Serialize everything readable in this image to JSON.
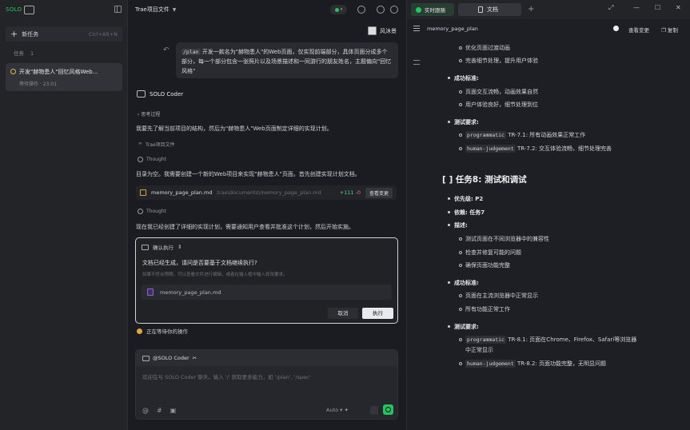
{
  "left": {
    "logo_text": "SOLO",
    "logo_box": "⊡",
    "new_task_label": "新任务",
    "new_task_shortcut": "Ctrl+Alt+N",
    "tasks_label": "任务",
    "tasks_count": "1",
    "task_title": "开发\"赫物患人\"回忆风格Web...",
    "task_status": "等待操作 · 23:01"
  },
  "mid": {
    "project_title": "Trae项目文件",
    "status_indicator": "on",
    "user_name": "风沐景",
    "user_bubble_cmd": "/plan",
    "user_bubble_text": "开发一款名为\"赫物患人\"的Web页面，仅实现前端部分，具体页面分成多个部分，每一个部分包含一张照片以及场景描述和一同游行的朋友姓名，主题偏向\"回忆风格\"",
    "agent_name": "SOLO Coder",
    "thinking_label": "思考过程",
    "msg1": "我要先了解当前项目的结构，然后为\"赫物患人\"Web页面制定详细的实现计划。",
    "ref_label": "Trae项目文件",
    "thought_label": "Thought",
    "msg2": "目录为空。我需要创建一个新的Web项目来实现\"赫物患人\"页面。首先创建实现计划文档。",
    "file_name": "memory_page_plan.md",
    "file_path": ".trae\\documents\\memory_page_plan.md",
    "file_add": "+111",
    "file_del": "-0",
    "view_change_btn": "查看变更",
    "thought_label2": "Thought",
    "msg3": "现在我已经创建了详细的实现计划，需要通知用户查看并批准这个计划，然后开始实施。",
    "confirm_header": "确认执行",
    "confirm_question": "文档已经生成，请问是否要基于文档继续执行?",
    "confirm_hint": "如果不符合预期，可以查看文件进行编辑，或者在输入框中输入修改要求。",
    "confirm_file": "memory_page_plan.md",
    "cancel_label": "取消",
    "execute_label": "执行",
    "waiting_text": "正在等待你的操作",
    "input_agent": "@SOLO Coder",
    "input_placeholder": "欢迎在与 SOLO Coder 聊天。输入 '/' 获取更多能力，如 '/plan', '/spec'",
    "model_label": "Auto",
    "accent_color": "#22c55e"
  },
  "right": {
    "tab_live": "实时跟随",
    "tab_doc": "文档",
    "doc_filename": "memory_page_plan",
    "view_changes": "查看变更",
    "copy": "复制",
    "lines": {
      "a1": "优化页面过渡动画",
      "a2": "完善细节处理，提升用户体验",
      "s1": "成功标准:",
      "s1a": "页面交互流畅，动画效果自然",
      "s1b": "用户体验良好，细节处理到位",
      "t1": "测试要求:",
      "t1a_code": "programmatic",
      "t1a_text": "TR-7.1: 所有动画效果正常工作",
      "t1b_code": "human-judgement",
      "t1b_text": "TR-7.2: 交互体验流畅，细节处理完善",
      "h8": "[ ] 任务8: 测试和调试",
      "p": "优先级: P2",
      "dep": "依赖: 任务7",
      "desc": "描述:",
      "d1": "测试页面在不同浏览器中的兼容性",
      "d2": "检查并修复可能的问题",
      "d3": "确保页面功能完整",
      "s2": "成功标准:",
      "s2a": "页面在主流浏览器中正常显示",
      "s2b": "所有功能正常工作",
      "t2": "测试要求:",
      "t2a_code": "programmatic",
      "t2a_text": "TR-8.1: 页面在Chrome、Firefox、Safari等浏览器",
      "t2a_text2": "中正常显示",
      "t2b_code": "human-judgement",
      "t2b_text": "TR-8.2: 页面功能完整，无明显问题"
    }
  }
}
